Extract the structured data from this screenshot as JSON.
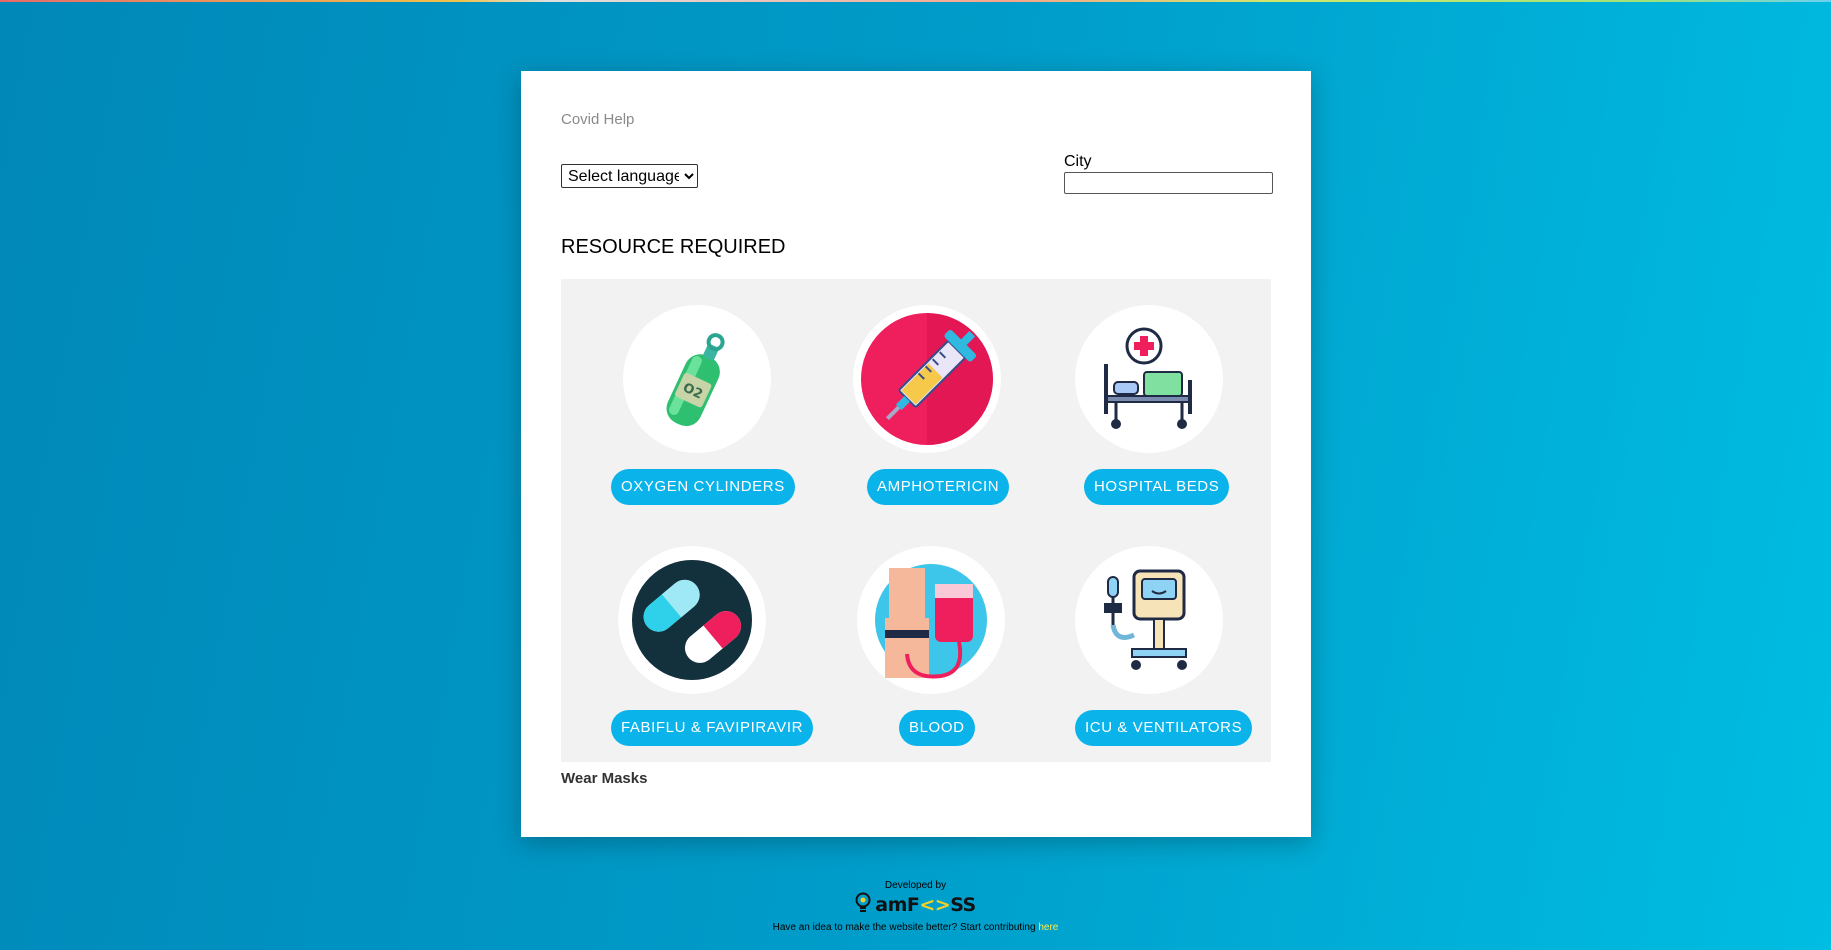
{
  "site": {
    "title": "Covid Help"
  },
  "language": {
    "selected": "Select language"
  },
  "city": {
    "label": "City",
    "value": ""
  },
  "section": {
    "title": "RESOURCE REQUIRED"
  },
  "resources": [
    {
      "label": "OXYGEN CYLINDERS",
      "icon": "oxygen-cylinder-icon"
    },
    {
      "label": "AMPHOTERICIN",
      "icon": "syringe-icon"
    },
    {
      "label": "HOSPITAL BEDS",
      "icon": "hospital-bed-icon"
    },
    {
      "label": "FABIFLU & FAVIPIRAVIR",
      "icon": "capsule-pills-icon"
    },
    {
      "label": "BLOOD",
      "icon": "blood-donation-icon"
    },
    {
      "label": "ICU & VENTILATORS",
      "icon": "ventilator-icon"
    }
  ],
  "note": {
    "text": "Wear Masks"
  },
  "footer": {
    "developed_by": "Developed by",
    "logo_text_pre": "amF",
    "logo_text_mid": "<>",
    "logo_text_post": "SS",
    "contribute_text": "Have an idea to make the website better? Start contributing",
    "contribute_link": "here"
  },
  "colors": {
    "accent": "#0ab3ea",
    "background_start": "#0088b8",
    "background_end": "#00bde2",
    "link": "#ffe74a"
  }
}
